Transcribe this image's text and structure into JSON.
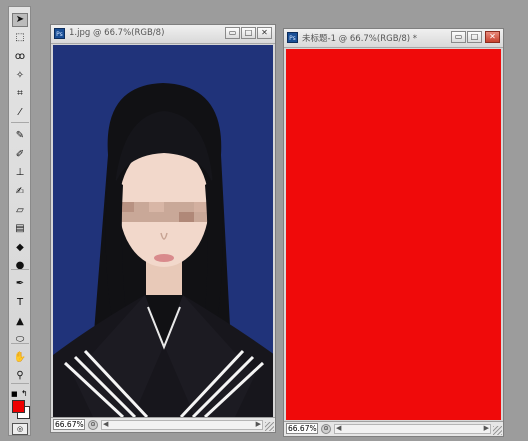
{
  "toolbar": {
    "tools": [
      {
        "name": "move-tool-icon",
        "glyph": "➤"
      },
      {
        "name": "marquee-tool-icon",
        "glyph": "⬚"
      },
      {
        "name": "lasso-tool-icon",
        "glyph": "ꝏ"
      },
      {
        "name": "quick-selection-tool-icon",
        "glyph": "✧"
      },
      {
        "name": "crop-tool-icon",
        "glyph": "⌗"
      },
      {
        "name": "eyedropper-tool-icon",
        "glyph": "⁄"
      },
      {
        "name": "healing-brush-tool-icon",
        "glyph": "✎"
      },
      {
        "name": "brush-tool-icon",
        "glyph": "✐"
      },
      {
        "name": "clone-stamp-tool-icon",
        "glyph": "⊥"
      },
      {
        "name": "history-brush-tool-icon",
        "glyph": "✍"
      },
      {
        "name": "eraser-tool-icon",
        "glyph": "▱"
      },
      {
        "name": "gradient-tool-icon",
        "glyph": "▤"
      },
      {
        "name": "blur-tool-icon",
        "glyph": "◆"
      },
      {
        "name": "dodge-tool-icon",
        "glyph": "●"
      },
      {
        "name": "pen-tool-icon",
        "glyph": "✒"
      },
      {
        "name": "type-tool-icon",
        "glyph": "T"
      },
      {
        "name": "path-selection-tool-icon",
        "glyph": "▲"
      },
      {
        "name": "shape-tool-icon",
        "glyph": "⬭"
      },
      {
        "name": "hand-tool-icon",
        "glyph": "✋"
      },
      {
        "name": "zoom-tool-icon",
        "glyph": "⚲"
      }
    ],
    "foreground_color": "#ee0000",
    "background_color": "#ffffff"
  },
  "windows": [
    {
      "id": "photo",
      "title": "1.jpg @ 66.7%(RGB/8)",
      "zoom": "66.67%",
      "buttons": {
        "minimize": "▭",
        "maximize": "□",
        "close": "✕"
      }
    },
    {
      "id": "new-doc",
      "title": "未标题-1 @ 66.7%(RGB/8) *",
      "zoom": "66.67%",
      "canvas_color": "#f00a0a",
      "buttons": {
        "minimize": "▭",
        "maximize": "□",
        "close": "✕"
      }
    }
  ]
}
